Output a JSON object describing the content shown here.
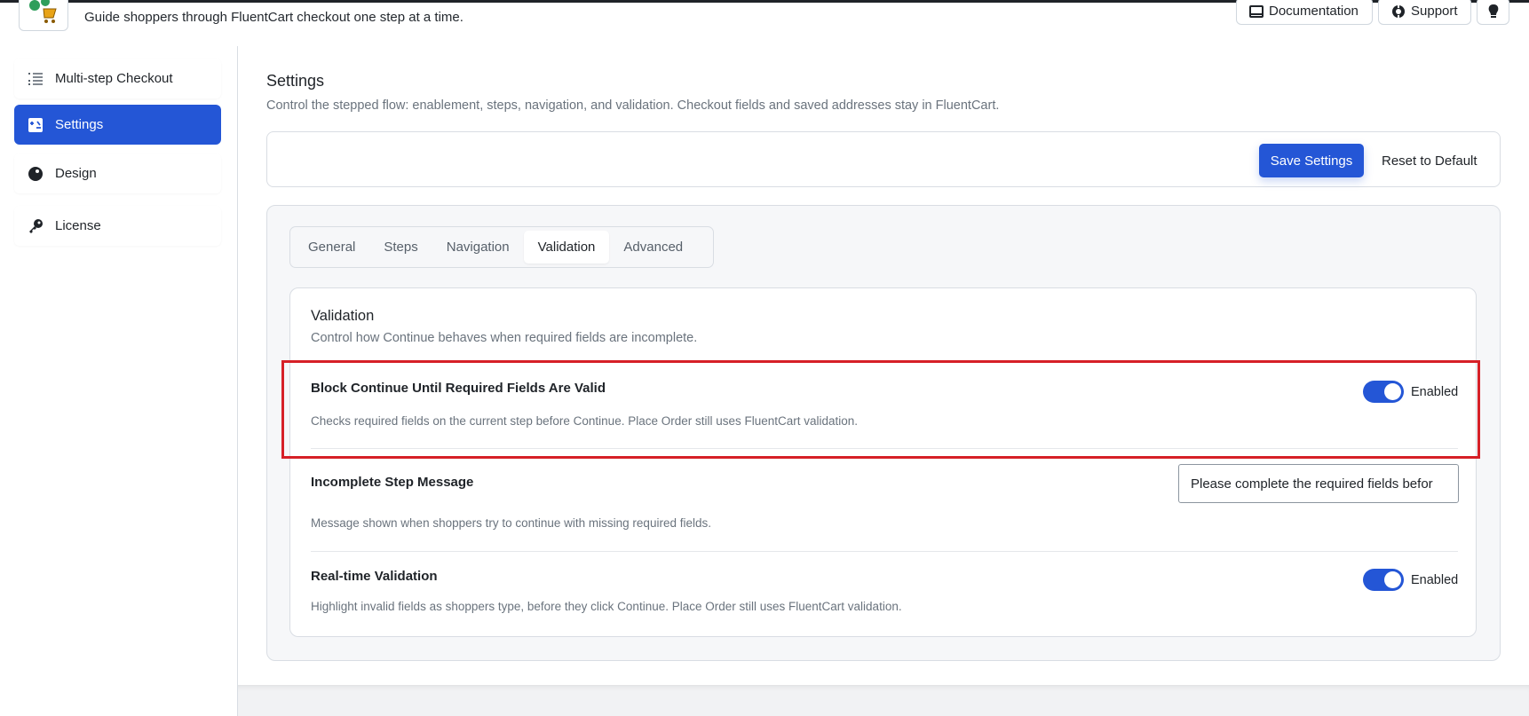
{
  "header": {
    "subtitle": "Guide shoppers through FluentCart checkout one step at a time.",
    "buttons": {
      "documentation": "Documentation",
      "support": "Support"
    }
  },
  "sidebar": {
    "items": [
      {
        "label": "Multi-step Checkout",
        "icon": "list-icon"
      },
      {
        "label": "Settings",
        "icon": "settings-icon",
        "active": true
      },
      {
        "label": "Design",
        "icon": "palette-icon"
      },
      {
        "label": "License",
        "icon": "key-icon"
      }
    ]
  },
  "main": {
    "title": "Settings",
    "description": "Control the stepped flow: enablement, steps, navigation, and validation. Checkout fields and saved addresses stay in FluentCart.",
    "toolbar": {
      "save_label": "Save Settings",
      "reset_label": "Reset to Default"
    },
    "tabs": [
      {
        "label": "General"
      },
      {
        "label": "Steps"
      },
      {
        "label": "Navigation"
      },
      {
        "label": "Validation",
        "active": true
      },
      {
        "label": "Advanced"
      }
    ],
    "validation": {
      "title": "Validation",
      "description": "Control how Continue behaves when required fields are incomplete.",
      "block_continue": {
        "title": "Block Continue Until Required Fields Are Valid",
        "help": "Checks required fields on the current step before Continue. Place Order still uses FluentCart validation.",
        "toggle_label": "Enabled"
      },
      "incomplete_message": {
        "title": "Incomplete Step Message",
        "help": "Message shown when shoppers try to continue with missing required fields.",
        "value": "Please complete the required fields befor"
      },
      "realtime": {
        "title": "Real-time Validation",
        "help": "Highlight invalid fields as shoppers type, before they click Continue. Place Order still uses FluentCart validation.",
        "toggle_label": "Enabled"
      }
    }
  },
  "colors": {
    "accent": "#2456d6",
    "highlight": "#d62027"
  }
}
